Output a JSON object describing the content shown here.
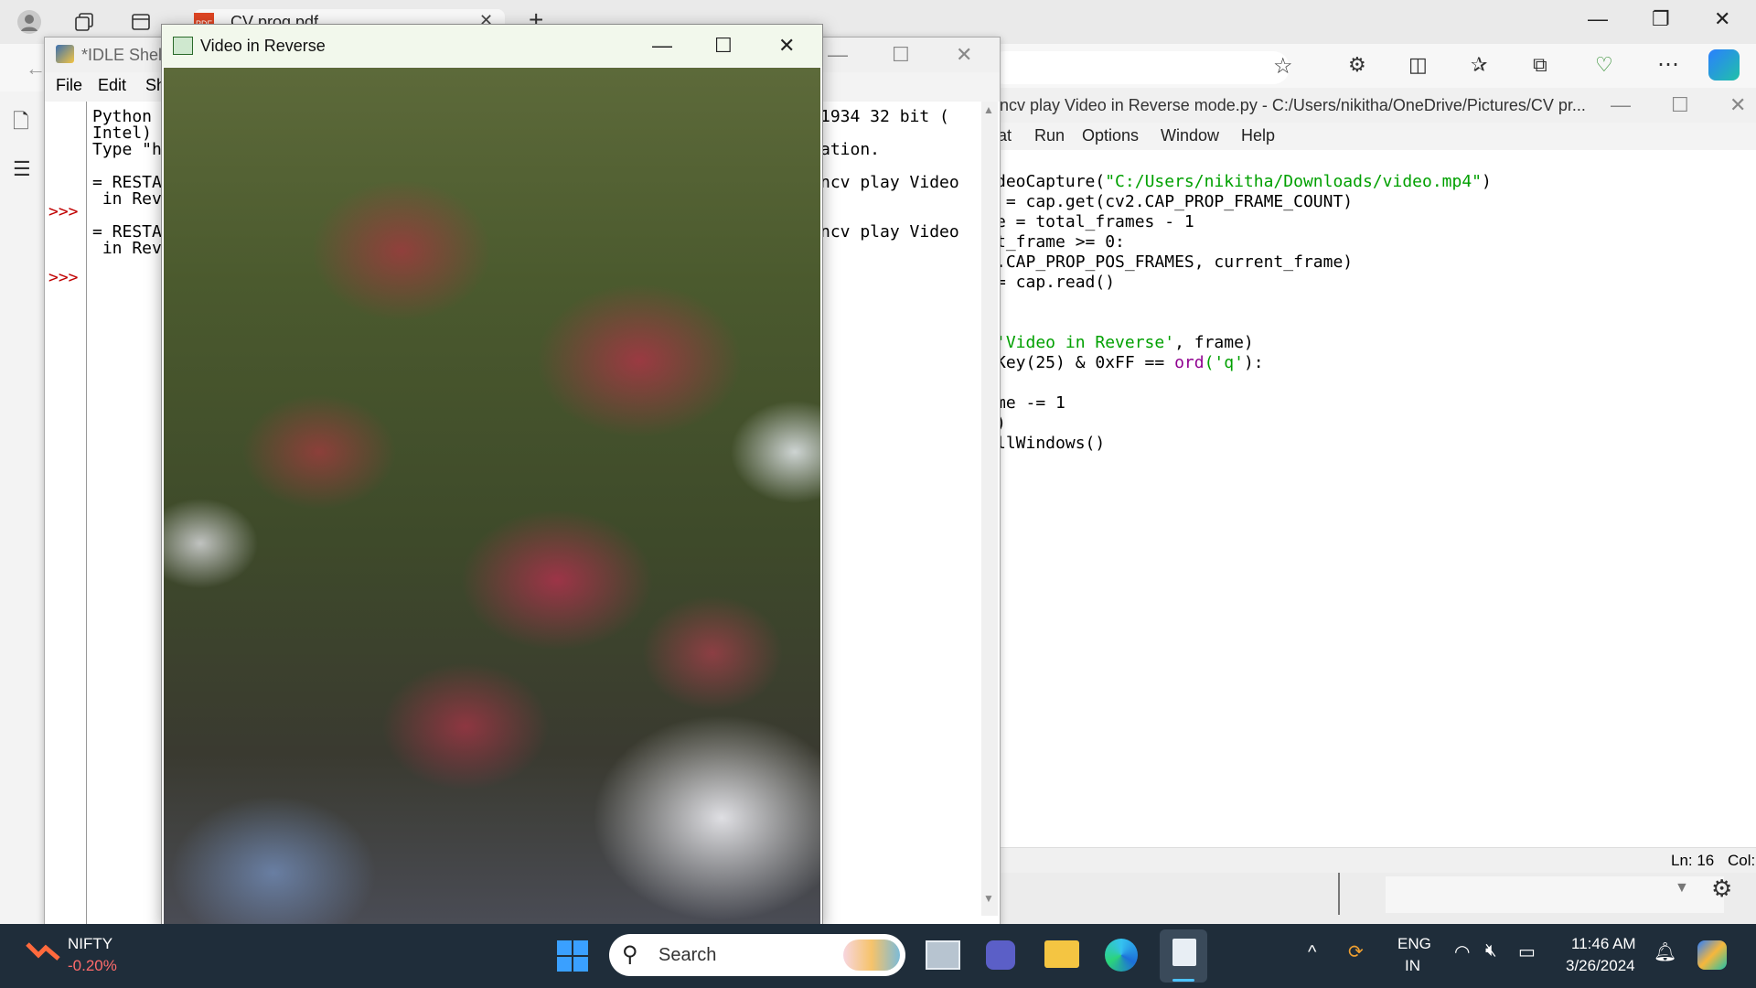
{
  "browser": {
    "tab_title": "CV prog.pdf",
    "new_tab": "+",
    "controls": {
      "minimize": "—",
      "restore": "❐",
      "close": "✕"
    }
  },
  "editor": {
    "title": "ncv play Video in Reverse mode.py - C:/Users/nikitha/OneDrive/Pictures/CV pr...",
    "menu": [
      "at",
      "Run",
      "Options",
      "Window",
      "Help"
    ],
    "code_lines": [
      {
        "plain": "deoCapture(",
        "str": "\"C:/Users/nikitha/Downloads/video.mp4\"",
        "tail": ")"
      },
      {
        "plain": " = cap.get(cv2.CAP_PROP_FRAME_COUNT)"
      },
      {
        "plain": "e = total_frames - 1"
      },
      {
        "plain": "t_frame >= 0:"
      },
      {
        "plain": ".CAP_PROP_POS_FRAMES, current_frame)"
      },
      {
        "plain": "= cap.read()"
      },
      {
        "plain": ""
      },
      {
        "plain": ""
      },
      {
        "plain": "",
        "str": "'Video in Reverse'",
        "tail": ", frame)"
      },
      {
        "plain": "Key(25) & 0xFF == ",
        "bi": "ord",
        "str": "('q'",
        "tail": "):"
      },
      {
        "plain": ""
      },
      {
        "plain": "me -= 1"
      },
      {
        "plain": ")"
      },
      {
        "plain": "llWindows()"
      }
    ],
    "status": {
      "ln": "Ln: 16",
      "col": "Col:"
    }
  },
  "idle": {
    "title": "*IDLE Shell",
    "menu": [
      "File",
      "Edit",
      "Sh"
    ],
    "prompt": ">>>",
    "lines_left": [
      "Python",
      "Intel)",
      "Type \"h",
      "",
      "= RESTA",
      " in Rev",
      "",
      "= RESTA",
      " in Rev"
    ],
    "lines_right": [
      "1934 32 bit (",
      "",
      "ation.",
      "",
      "ncv play Video",
      "",
      "",
      "ncv play Video"
    ]
  },
  "video": {
    "title": "Video in Reverse"
  },
  "taskbar": {
    "nifty_label": "NIFTY",
    "nifty_change": "-0.20%",
    "search_placeholder": "Search",
    "lang": "ENG",
    "region": "IN",
    "time": "11:46 AM",
    "date": "3/26/2024"
  },
  "colors": {
    "taskbar": "#1f2d3a",
    "string": "#00a000",
    "builtin": "#900090",
    "prompt": "#c00000",
    "nifty_negative": "#ff6b6b"
  }
}
